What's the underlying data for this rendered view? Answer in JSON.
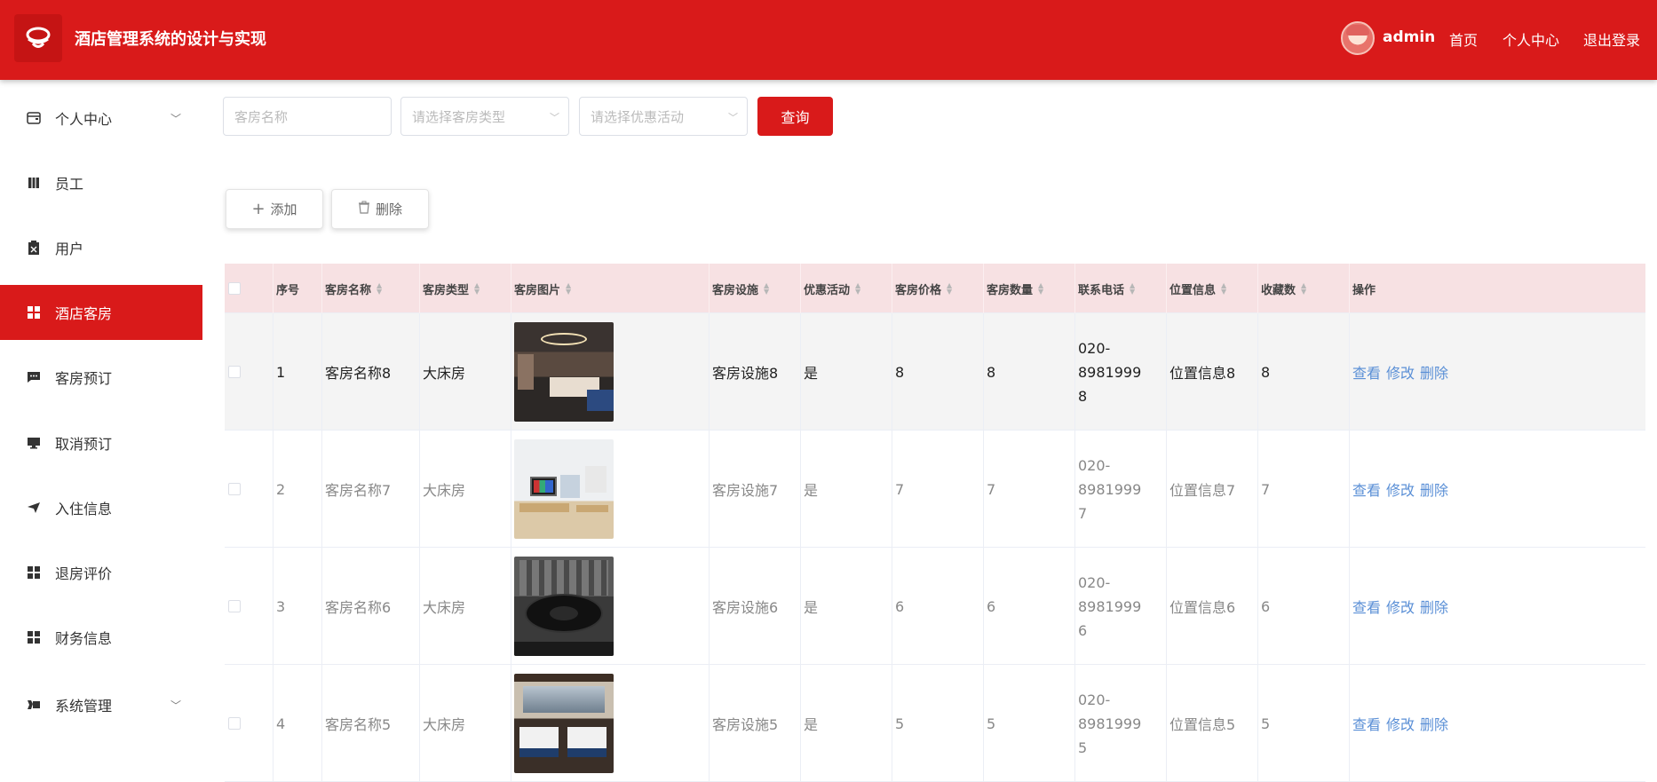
{
  "header": {
    "title": "酒店管理系统的设计与实现",
    "user": "admin",
    "nav": [
      "首页",
      "个人中心",
      "退出登录"
    ]
  },
  "sidebar": {
    "items": [
      {
        "label": "个人中心",
        "icon": "wallet-icon",
        "expandable": true
      },
      {
        "label": "员工",
        "icon": "book-icon"
      },
      {
        "label": "用户",
        "icon": "clipboard-icon"
      },
      {
        "label": "酒店客房",
        "icon": "grid-icon",
        "active": true
      },
      {
        "label": "客房预订",
        "icon": "chat-icon"
      },
      {
        "label": "取消预订",
        "icon": "monitor-icon"
      },
      {
        "label": "入住信息",
        "icon": "send-icon"
      },
      {
        "label": "退房评价",
        "icon": "grid-icon"
      },
      {
        "label": "财务信息",
        "icon": "grid-icon"
      },
      {
        "label": "系统管理",
        "icon": "video-icon",
        "expandable": true
      }
    ]
  },
  "search": {
    "room_name_placeholder": "客房名称",
    "room_type_placeholder": "请选择客房类型",
    "promo_placeholder": "请选择优惠活动",
    "query_label": "查询"
  },
  "toolbar": {
    "add_label": "添加",
    "delete_label": "删除"
  },
  "table": {
    "columns": [
      "序号",
      "客房名称",
      "客房类型",
      "客房图片",
      "客房设施",
      "优惠活动",
      "客房价格",
      "客房数量",
      "联系电话",
      "位置信息",
      "收藏数",
      "操作"
    ],
    "actions": [
      "查看",
      "修改",
      "删除"
    ],
    "rows": [
      {
        "index": "1",
        "name": "客房名称8",
        "type": "大床房",
        "image": "dark-hotel-suite",
        "facility": "客房设施8",
        "promo": "是",
        "price": "8",
        "count": "8",
        "phone_a": "020-8981999",
        "phone_b": "8",
        "location": "位置信息8",
        "favorites": "8"
      },
      {
        "index": "2",
        "name": "客房名称7",
        "type": "大床房",
        "image": "bright-room-tv",
        "facility": "客房设施7",
        "promo": "是",
        "price": "7",
        "count": "7",
        "phone_a": "020-8981999",
        "phone_b": "7",
        "location": "位置信息7",
        "favorites": "7"
      },
      {
        "index": "3",
        "name": "客房名称6",
        "type": "大床房",
        "image": "banquet-table",
        "facility": "客房设施6",
        "promo": "是",
        "price": "6",
        "count": "6",
        "phone_a": "020-8981999",
        "phone_b": "6",
        "location": "位置信息6",
        "favorites": "6"
      },
      {
        "index": "4",
        "name": "客房名称5",
        "type": "大床房",
        "image": "twin-bed-room",
        "facility": "客房设施5",
        "promo": "是",
        "price": "5",
        "count": "5",
        "phone_a": "020-8981999",
        "phone_b": "5",
        "location": "位置信息5",
        "favorites": "5"
      }
    ]
  },
  "colors": {
    "brand": "#d91a1a",
    "header_row": "#f7e1e3",
    "link": "#5a8fd6"
  }
}
